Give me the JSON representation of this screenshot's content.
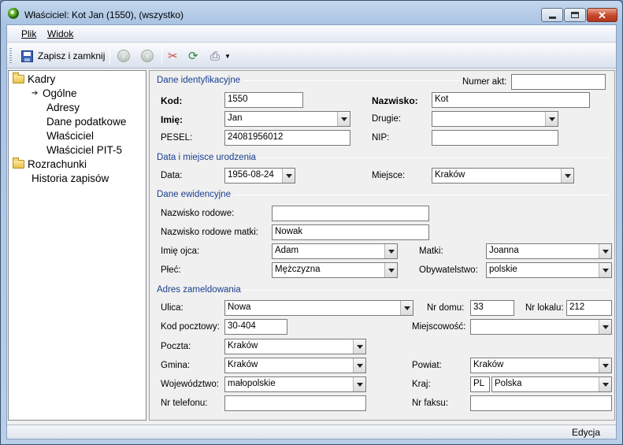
{
  "window": {
    "title": "Właściciel: Kot Jan (1550), (wszystko)"
  },
  "menu": {
    "file_label": "Plik",
    "view_label": "Widok"
  },
  "toolbar": {
    "save_label": "Zapisz i zamknij"
  },
  "tree": {
    "kadry": "Kadry",
    "ogolne": "Ogólne",
    "adresy": "Adresy",
    "dane_podatkowe": "Dane podatkowe",
    "wlasciciel": "Właściciel",
    "wlasciciel_pit5": "Właściciel PIT-5",
    "rozrachunki": "Rozrachunki",
    "historia": "Historia zapisów"
  },
  "identification": {
    "group_label": "Dane identyfikacyjne",
    "numer_akt_label": "Numer akt:",
    "numer_akt_value": "",
    "kod_label": "Kod:",
    "kod_value": "1550",
    "nazwisko_label": "Nazwisko:",
    "nazwisko_value": "Kot",
    "imie_label": "Imię:",
    "imie_value": "Jan",
    "drugie_label": "Drugie:",
    "drugie_value": "",
    "pesel_label": "PESEL:",
    "pesel_value": "24081956012",
    "nip_label": "NIP:",
    "nip_value": ""
  },
  "birth": {
    "group_label": "Data i miejsce urodzenia",
    "data_label": "Data:",
    "data_value": "1956-08-24",
    "miejsce_label": "Miejsce:",
    "miejsce_value": "Kraków"
  },
  "records": {
    "group_label": "Dane ewidencyjne",
    "nazwisko_rodowe_label": "Nazwisko rodowe:",
    "nazwisko_rodowe_value": "",
    "nazwisko_matki_label": "Nazwisko rodowe matki:",
    "nazwisko_matki_value": "Nowak",
    "imie_ojca_label": "Imię ojca:",
    "imie_ojca_value": "Adam",
    "matki_label": "Matki:",
    "matki_value": "Joanna",
    "plec_label": "Płeć:",
    "plec_value": "Mężczyzna",
    "obywatelstwo_label": "Obywatelstwo:",
    "obywatelstwo_value": "polskie"
  },
  "address": {
    "group_label": "Adres zameldowania",
    "ulica_label": "Ulica:",
    "ulica_value": "Nowa",
    "nr_domu_label": "Nr domu:",
    "nr_domu_value": "33",
    "nr_lokalu_label": "Nr lokalu:",
    "nr_lokalu_value": "212",
    "kod_pocztowy_label": "Kod pocztowy:",
    "kod_pocztowy_value": "30-404",
    "miejscowosc_label": "Miejscowość:",
    "miejscowosc_value": "",
    "poczta_label": "Poczta:",
    "poczta_value": "Kraków",
    "gmina_label": "Gmina:",
    "gmina_value": "Kraków",
    "powiat_label": "Powiat:",
    "powiat_value": "Kraków",
    "wojewodztwo_label": "Województwo:",
    "wojewodztwo_value": "małopolskie",
    "kraj_label": "Kraj:",
    "kraj_code": "PL",
    "kraj_value": "Polska",
    "telefon_label": "Nr telefonu:",
    "telefon_value": "",
    "faks_label": "Nr faksu:",
    "faks_value": ""
  },
  "status": {
    "mode": "Edycja"
  }
}
